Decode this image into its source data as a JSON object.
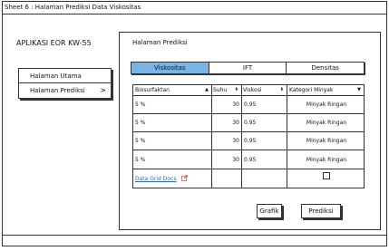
{
  "sheet": {
    "title": "Sheet 6 : Halaman Prediksi Data Viskositas"
  },
  "app": {
    "name": "APLIKASI EOR KW-55"
  },
  "nav": {
    "items": [
      {
        "label": "Halaman Utama"
      },
      {
        "label": "Halaman Prediksi",
        "chevron": ">"
      }
    ]
  },
  "panel": {
    "title": "Halaman Prediksi",
    "tabs": [
      {
        "label": "Viskositas",
        "active": true
      },
      {
        "label": "IFT",
        "active": false
      },
      {
        "label": "Densitas",
        "active": false
      }
    ],
    "grid": {
      "columns": [
        {
          "label": "Biosurfaktan",
          "sort_icon": "▲"
        },
        {
          "label": "Suhu",
          "sort_icon": "⬍"
        },
        {
          "label": "Viskosi",
          "sort_icon": "⬍"
        },
        {
          "label": "Kategori Minyak",
          "sort_icon": "▼"
        }
      ],
      "rows": [
        {
          "biosurfaktan": "5 %",
          "suhu": "30",
          "viskosi": "0.95",
          "kategori": "Minyak Ringan"
        },
        {
          "biosurfaktan": "5 %",
          "suhu": "30",
          "viskosi": "0.95",
          "kategori": "Minyak Ringan"
        },
        {
          "biosurfaktan": "5 %",
          "suhu": "30",
          "viskosi": "0.95",
          "kategori": "Minyak Ringan"
        },
        {
          "biosurfaktan": "5 %",
          "suhu": "30",
          "viskosi": "0.95",
          "kategori": "Minyak Ringan"
        }
      ],
      "footer": {
        "link_label": "Data Grid Docs",
        "link_icon": "external-link-icon"
      }
    },
    "buttons": {
      "grafik": "Grafik",
      "prediksi": "Prediksi"
    }
  }
}
